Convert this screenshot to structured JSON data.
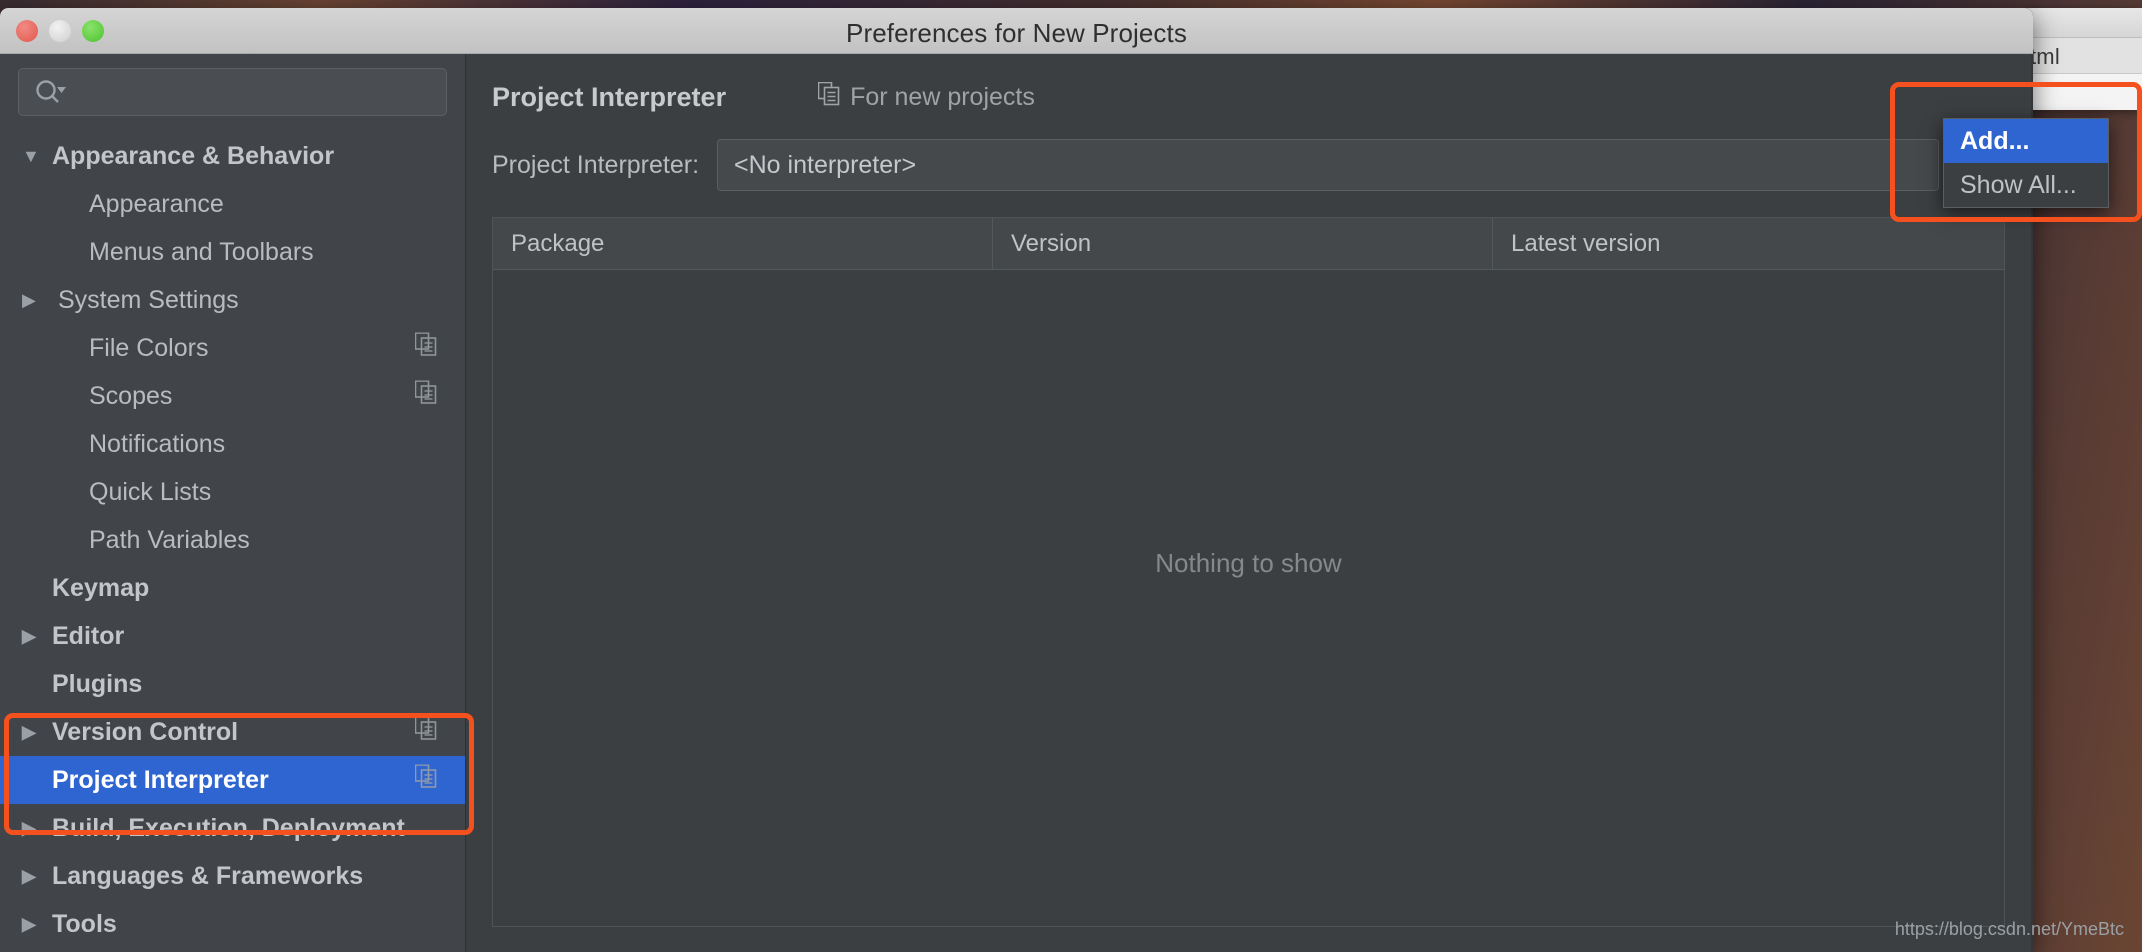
{
  "window": {
    "title": "Preferences for New Projects",
    "traffic_lights": [
      "close-button",
      "minimize-button",
      "zoom-button"
    ]
  },
  "background_window": {
    "tab_text": "tml"
  },
  "search": {
    "value": "",
    "placeholder": "",
    "icon": "search-icon"
  },
  "sidebar": {
    "items": [
      {
        "label": "Appearance & Behavior",
        "level": 0,
        "bold": true,
        "arrow": "down",
        "icon": null,
        "selected": false
      },
      {
        "label": "Appearance",
        "level": 1,
        "bold": false,
        "arrow": null,
        "icon": null,
        "selected": false
      },
      {
        "label": "Menus and Toolbars",
        "level": 1,
        "bold": false,
        "arrow": null,
        "icon": null,
        "selected": false
      },
      {
        "label": "System Settings",
        "level": 1,
        "bold": false,
        "arrow": "right",
        "icon": null,
        "selected": false
      },
      {
        "label": "File Colors",
        "level": 1,
        "bold": false,
        "arrow": null,
        "icon": "copy-icon",
        "selected": false
      },
      {
        "label": "Scopes",
        "level": 1,
        "bold": false,
        "arrow": null,
        "icon": "copy-icon",
        "selected": false
      },
      {
        "label": "Notifications",
        "level": 1,
        "bold": false,
        "arrow": null,
        "icon": null,
        "selected": false
      },
      {
        "label": "Quick Lists",
        "level": 1,
        "bold": false,
        "arrow": null,
        "icon": null,
        "selected": false
      },
      {
        "label": "Path Variables",
        "level": 1,
        "bold": false,
        "arrow": null,
        "icon": null,
        "selected": false
      },
      {
        "label": "Keymap",
        "level": 0,
        "bold": true,
        "arrow": null,
        "icon": null,
        "selected": false
      },
      {
        "label": "Editor",
        "level": 0,
        "bold": true,
        "arrow": "right",
        "icon": null,
        "selected": false
      },
      {
        "label": "Plugins",
        "level": 0,
        "bold": true,
        "arrow": null,
        "icon": null,
        "selected": false
      },
      {
        "label": "Version Control",
        "level": 0,
        "bold": true,
        "arrow": "right",
        "icon": "copy-icon",
        "selected": false
      },
      {
        "label": "Project Interpreter",
        "level": 0,
        "bold": true,
        "arrow": null,
        "icon": "copy-icon",
        "selected": true
      },
      {
        "label": "Build, Execution, Deployment",
        "level": 0,
        "bold": true,
        "arrow": "right",
        "icon": null,
        "selected": false
      },
      {
        "label": "Languages & Frameworks",
        "level": 0,
        "bold": true,
        "arrow": "right",
        "icon": null,
        "selected": false
      },
      {
        "label": "Tools",
        "level": 0,
        "bold": true,
        "arrow": "right",
        "icon": null,
        "selected": false
      }
    ]
  },
  "content": {
    "page_title": "Project Interpreter",
    "scope_chip": {
      "label": "For new projects",
      "icon": "copy-icon"
    },
    "interpreter": {
      "label": "Project Interpreter:",
      "value": "<No interpreter>",
      "arrow_icon": "chevron-down-icon"
    },
    "packages_table": {
      "columns": [
        "Package",
        "Version",
        "Latest version"
      ],
      "rows": [],
      "empty_text": "Nothing to show"
    }
  },
  "dropdown": {
    "items": [
      {
        "label": "Add...",
        "active": true
      },
      {
        "label": "Show All...",
        "active": false
      }
    ]
  },
  "annotations": {
    "colors": {
      "highlight": "#f4511e",
      "selection": "#2f65d0"
    }
  },
  "watermark": "https://blog.csdn.net/YmeBtc"
}
